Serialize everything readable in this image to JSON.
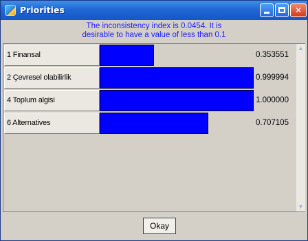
{
  "window": {
    "title": "Priorities",
    "icon": "app-icon"
  },
  "message": {
    "line1": "The inconsistency index is 0.0454.  It is",
    "line2": "desirable to have a value of less than 0.1"
  },
  "priorities": [
    {
      "label": "1 Finansal",
      "value_text": "0.353551",
      "value": 0.353551
    },
    {
      "label": "2 Çevresel olabilirlik",
      "value_text": "0.999994",
      "value": 0.999994
    },
    {
      "label": "4 Toplum algisi",
      "value_text": "1.000000",
      "value": 1.0
    },
    {
      "label": "6 Alternatives",
      "value_text": "0.707105",
      "value": 0.707105
    }
  ],
  "footer": {
    "okay_label": "Okay"
  },
  "colors": {
    "bar": "#0000ff",
    "message_text": "#1a1aff"
  }
}
